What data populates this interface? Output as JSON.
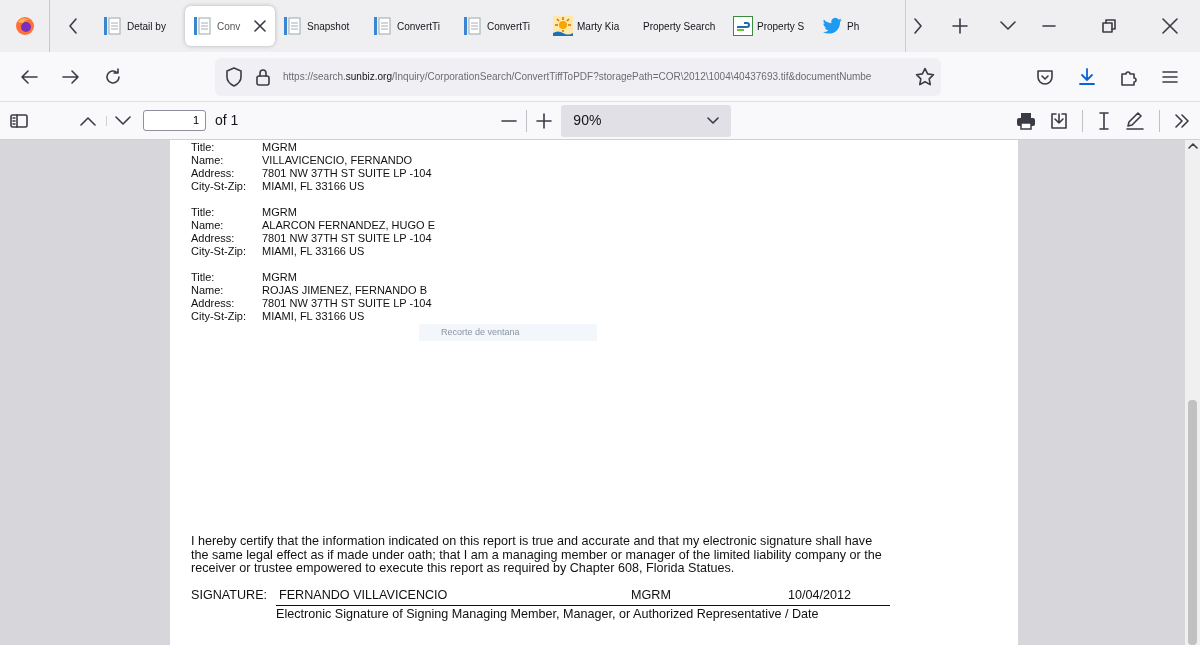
{
  "tabs": [
    {
      "title": "Detail by",
      "kind": "document",
      "selected": false
    },
    {
      "title": "Conv",
      "kind": "document",
      "selected": true
    },
    {
      "title": "Snapshot",
      "kind": "document",
      "selected": false
    },
    {
      "title": "ConvertTi",
      "kind": "document",
      "selected": false
    },
    {
      "title": "ConvertTi",
      "kind": "document",
      "selected": false
    },
    {
      "title": "Marty Kia",
      "kind": "sun",
      "selected": false
    },
    {
      "title": "Property Search",
      "kind": "plain",
      "selected": false
    },
    {
      "title": "Property S",
      "kind": "bracket",
      "selected": false
    },
    {
      "title": "Ph",
      "kind": "bird",
      "selected": false
    }
  ],
  "url": {
    "prefix": "https://search.",
    "domain": "sunbiz.org",
    "path": "/Inquiry/CorporationSearch/ConvertTiffToPDF?storagePath=COR\\2012\\1004\\40437693.tif&documentNumbe"
  },
  "pdf_toolbar": {
    "page": "1",
    "page_count": "of 1",
    "zoom": "90%"
  },
  "document": {
    "officers": [
      {
        "fields": [
          {
            "label": "Title:",
            "value": "MGRM"
          },
          {
            "label": "Name:",
            "value": "VILLAVICENCIO, FERNANDO"
          },
          {
            "label": "Address:",
            "value": "7801 NW 37TH ST SUITE LP -104"
          },
          {
            "label": "City-St-Zip:",
            "value": "MIAMI, FL  33166 US"
          }
        ]
      },
      {
        "fields": [
          {
            "label": "Title:",
            "value": "MGRM"
          },
          {
            "label": "Name:",
            "value": "ALARCON FERNANDEZ, HUGO E"
          },
          {
            "label": "Address:",
            "value": "7801 NW 37TH ST SUITE LP -104"
          },
          {
            "label": "City-St-Zip:",
            "value": "MIAMI, FL  33166 US"
          }
        ]
      },
      {
        "fields": [
          {
            "label": "Title:",
            "value": "MGRM"
          },
          {
            "label": "Name:",
            "value": "ROJAS JIMENEZ, FERNANDO B"
          },
          {
            "label": "Address:",
            "value": "7801 NW 37TH ST SUITE LP -104"
          },
          {
            "label": "City-St-Zip:",
            "value": "MIAMI, FL  33166 US"
          }
        ]
      }
    ],
    "snip_tooltip": "Recorte de ventana",
    "certification": "I hereby certify that the information indicated on this report is true and accurate and that my electronic signature shall have the same legal effect as if made under oath; that I am a managing member or manager of the limited liability company or the receiver or trustee empowered to execute this report as required by Chapter 608, Florida Statues.",
    "signature": {
      "label": "SIGNATURE:",
      "name": "FERNANDO VILLAVICENCIO",
      "title": "MGRM",
      "date": "10/04/2012",
      "caption": "Electronic Signature of Signing Managing Member, Manager, or Authorized Representative / Date"
    }
  }
}
